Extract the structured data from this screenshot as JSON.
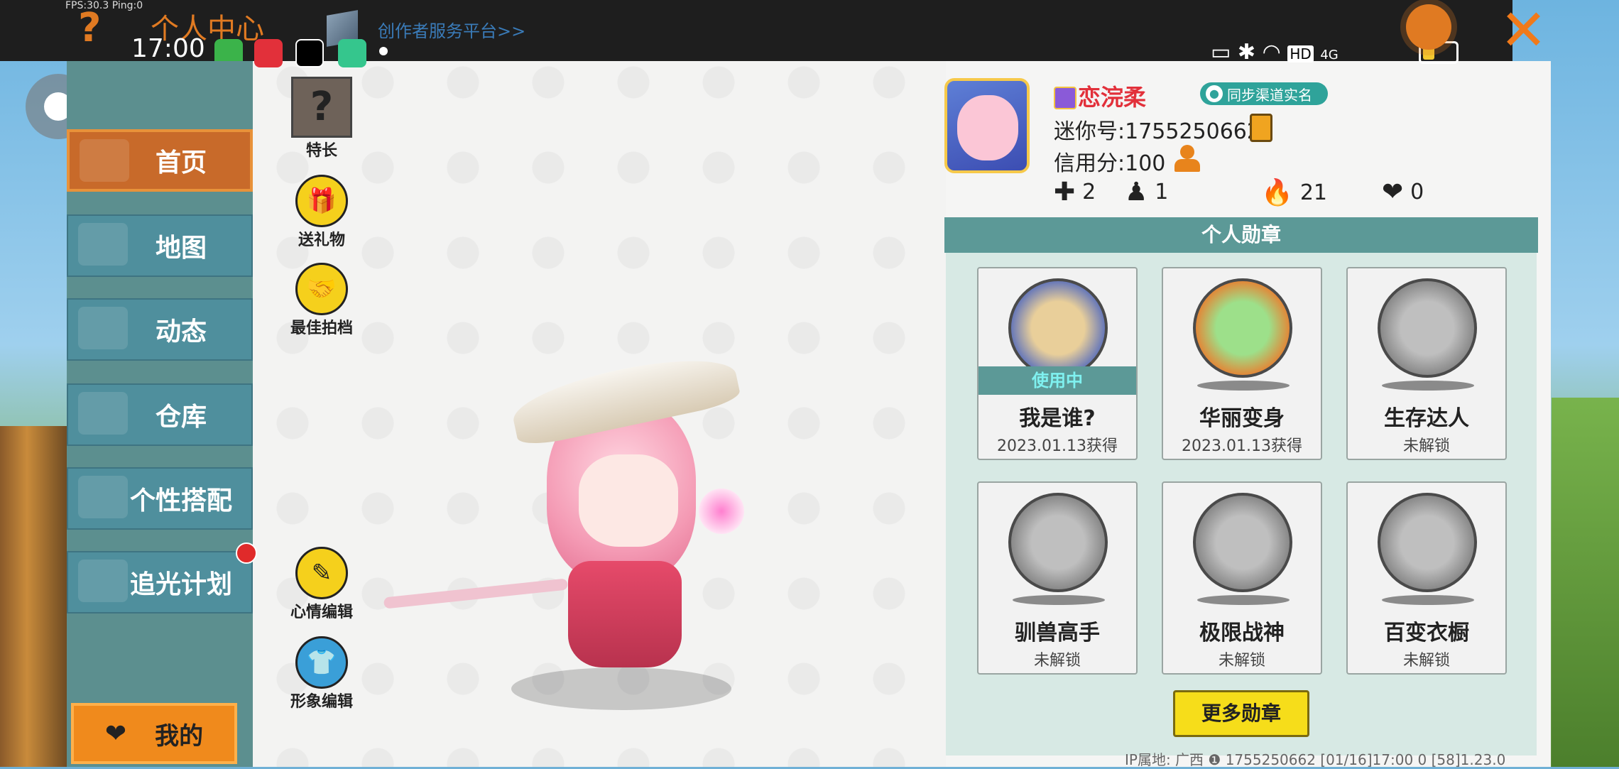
{
  "status_bar": {
    "fps": "FPS:30.3  Ping:0",
    "time": "17:00",
    "network": "4G",
    "hd": "HD"
  },
  "header": {
    "help_icon_glyph": "?",
    "title": "个人中心",
    "creator_link": "创作者服务平台>>",
    "settings_icon": "gear-icon",
    "close_glyph": "✕"
  },
  "sidebar": {
    "items": [
      {
        "label": "首页",
        "icon": "home-icon",
        "active": true
      },
      {
        "label": "地图",
        "icon": "map-icon",
        "active": false
      },
      {
        "label": "动态",
        "icon": "bell-icon",
        "active": false
      },
      {
        "label": "仓库",
        "icon": "house-icon",
        "active": false
      },
      {
        "label": "个性搭配",
        "icon": "outfit-icon",
        "active": false
      },
      {
        "label": "追光计划",
        "icon": "light-plan-icon",
        "active": false
      }
    ],
    "mine_label": "我的"
  },
  "tools": {
    "specialty": {
      "label": "特长",
      "glyph": "?"
    },
    "gift": {
      "label": "送礼物",
      "glyph": "🎁"
    },
    "partner": {
      "label": "最佳拍档",
      "glyph": "🤝"
    },
    "mood": {
      "label": "心情编辑",
      "glyph": "✎"
    },
    "appearance": {
      "label": "形象编辑",
      "glyph": "👕"
    }
  },
  "profile": {
    "nickname": "恋浣柔",
    "sync_button": "同步渠道实名",
    "mini_id": "迷你号:1755250662",
    "credit": "信用分:100",
    "stats": {
      "friends": "2",
      "fans": "1",
      "popularity": "21",
      "likes": "0"
    }
  },
  "medals": {
    "title": "个人勋章",
    "items": [
      {
        "name": "我是谁?",
        "sub": "2023.01.13获得",
        "status": "使用中",
        "style": "blue"
      },
      {
        "name": "华丽变身",
        "sub": "2023.01.13获得",
        "status": "",
        "style": "orange"
      },
      {
        "name": "生存达人",
        "sub": "未解锁",
        "status": "",
        "style": "gray"
      },
      {
        "name": "驯兽高手",
        "sub": "未解锁",
        "status": "",
        "style": "gray"
      },
      {
        "name": "极限战神",
        "sub": "未解锁",
        "status": "",
        "style": "gray"
      },
      {
        "name": "百变衣橱",
        "sub": "未解锁",
        "status": "",
        "style": "gray"
      }
    ],
    "more_button": "更多勋章"
  },
  "footer": {
    "text": "IP属地: 广西 ❶     1755250662    [01/16]17:00 0   [58]1.23.0"
  }
}
